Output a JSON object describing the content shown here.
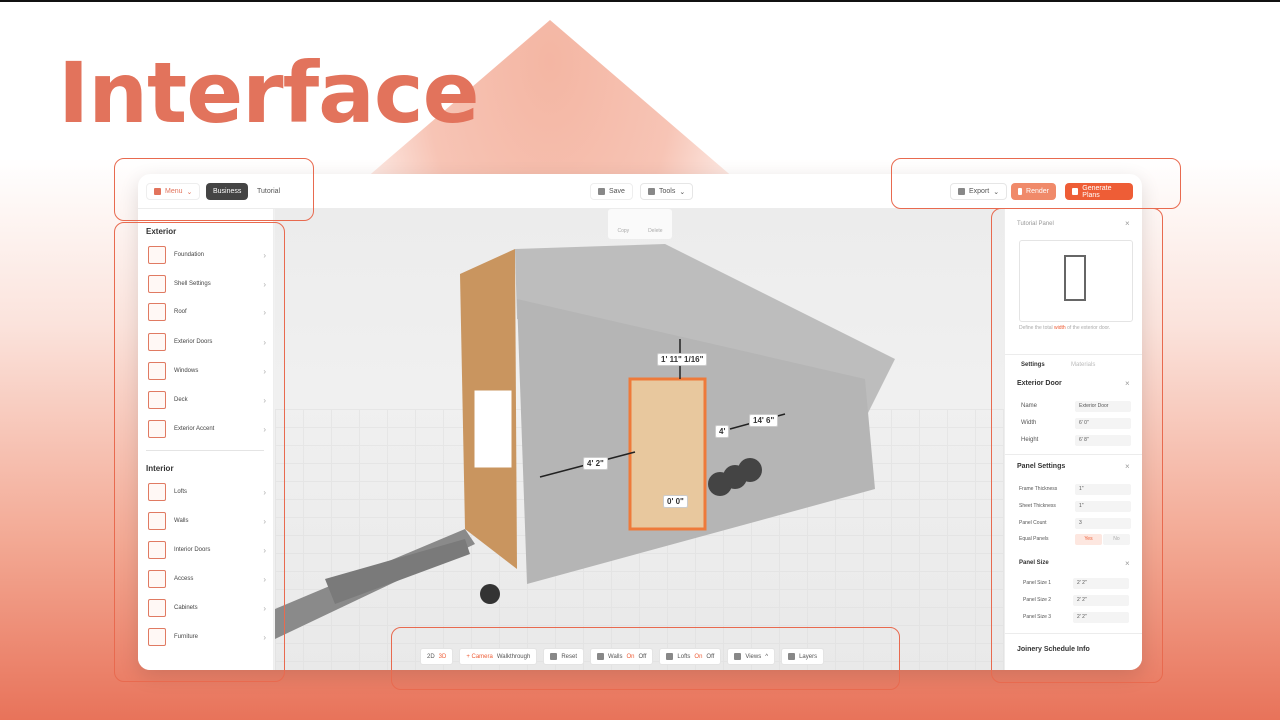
{
  "hero_title": "Interface",
  "topbar": {
    "menu": "Menu",
    "business": "Business",
    "tutorial": "Tutorial",
    "save": "Save",
    "tools": "Tools",
    "export": "Export",
    "render": "Render",
    "generate": "Generate Plans"
  },
  "toolbar_float": {
    "copy": "Copy",
    "delete": "Delete"
  },
  "sidebar": {
    "exterior_heading": "Exterior",
    "exterior": [
      "Foundation",
      "Shell Settings",
      "Roof",
      "Exterior Doors",
      "Windows",
      "Deck",
      "Exterior Accent"
    ],
    "interior_heading": "Interior",
    "interior": [
      "Lofts",
      "Walls",
      "Interior Doors",
      "Access",
      "Cabinets",
      "Furniture"
    ]
  },
  "dimensions": [
    "1' 11\" 1/16\"",
    "14' 6\"",
    "4'",
    "4' 2\"",
    "0' 0\""
  ],
  "bottombar": {
    "d2": "2D",
    "d3": "3D",
    "camera": "+ Camera",
    "walk": "Walkthrough",
    "reset": "Reset",
    "walls": "Walls",
    "walls_on": "On",
    "walls_off": "Off",
    "lofts": "Lofts",
    "lofts_on": "On",
    "lofts_off": "Off",
    "views": "Views",
    "layers": "Layers"
  },
  "right": {
    "tutorial_panel": "Tutorial Panel",
    "caption_a": "Define the total ",
    "caption_link": "width",
    "caption_b": " of the exterior door.",
    "tab_settings": "Settings",
    "tab_materials": "Materials",
    "ext_door": "Exterior Door",
    "name_l": "Name",
    "name_v": "Exterior Door",
    "width_l": "Width",
    "width_v": "6' 0\"",
    "height_l": "Height",
    "height_v": "6' 8\"",
    "panel_settings": "Panel Settings",
    "frame_l": "Frame Thickness",
    "frame_v": "1\"",
    "sheet_l": "Sheet Thickness",
    "sheet_v": "1\"",
    "count_l": "Panel Count",
    "count_v": "3",
    "equal_l": "Equal Panels",
    "yes": "Yes",
    "no": "No",
    "panel_size": "Panel Size",
    "ps1_l": "Panel Size 1",
    "ps1_v": "2' 2\"",
    "ps2_l": "Panel Size 2",
    "ps2_v": "2' 2\"",
    "ps3_l": "Panel Size 3",
    "ps3_v": "2' 2\"",
    "joinery": "Joinery Schedule Info"
  },
  "colors": {
    "accent": "#ee5d36",
    "highlight": "#e86a4f"
  }
}
